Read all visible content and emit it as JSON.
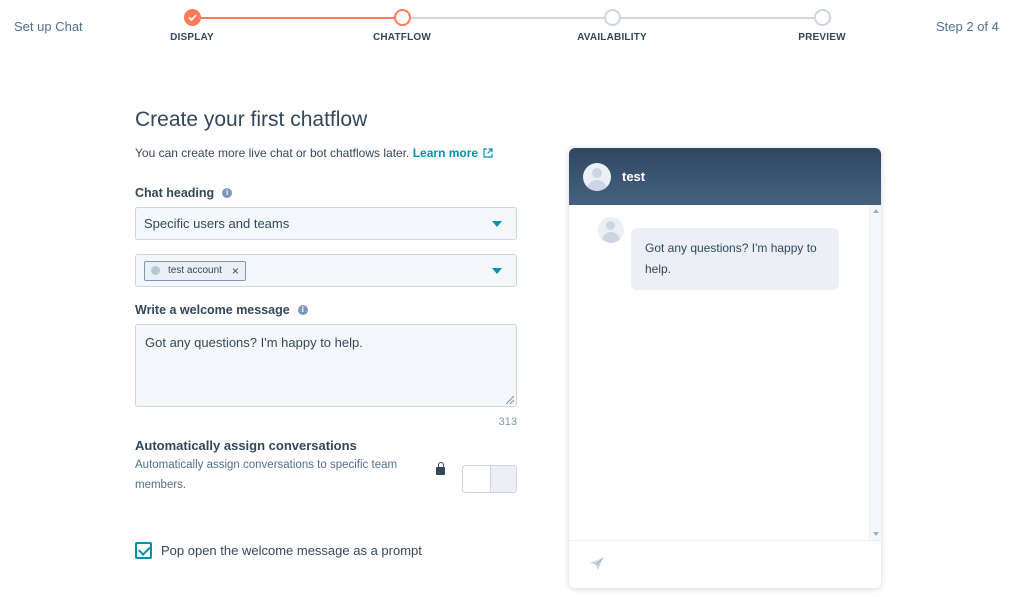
{
  "header": {
    "title": "Set up Chat",
    "step_count": "Step 2 of 4",
    "steps": [
      {
        "label": "DISPLAY",
        "state": "complete"
      },
      {
        "label": "CHATFLOW",
        "state": "current"
      },
      {
        "label": "AVAILABILITY",
        "state": "upcoming"
      },
      {
        "label": "PREVIEW",
        "state": "upcoming"
      }
    ]
  },
  "form": {
    "title": "Create your first chatflow",
    "description": "You can create more live chat or bot chatflows later.",
    "learn_more": "Learn more",
    "chat_heading": {
      "label": "Chat heading",
      "selected": "Specific users and teams"
    },
    "users": {
      "tag": "test account"
    },
    "welcome": {
      "label": "Write a welcome message",
      "value": "Got any questions? I'm happy to help.",
      "counter": "313"
    },
    "auto_assign": {
      "title": "Automatically assign conversations",
      "description": "Automatically assign conversations to specific team members.",
      "enabled": false
    },
    "popup": {
      "label": "Pop open the welcome message as a prompt",
      "checked": true
    }
  },
  "preview": {
    "name": "test",
    "message": "Got any questions? I'm happy to help."
  },
  "colors": {
    "accent": "#ff7a59",
    "link": "#0091ae",
    "preview_header": "#3f5a78",
    "bubble": "#eaf0f6"
  }
}
